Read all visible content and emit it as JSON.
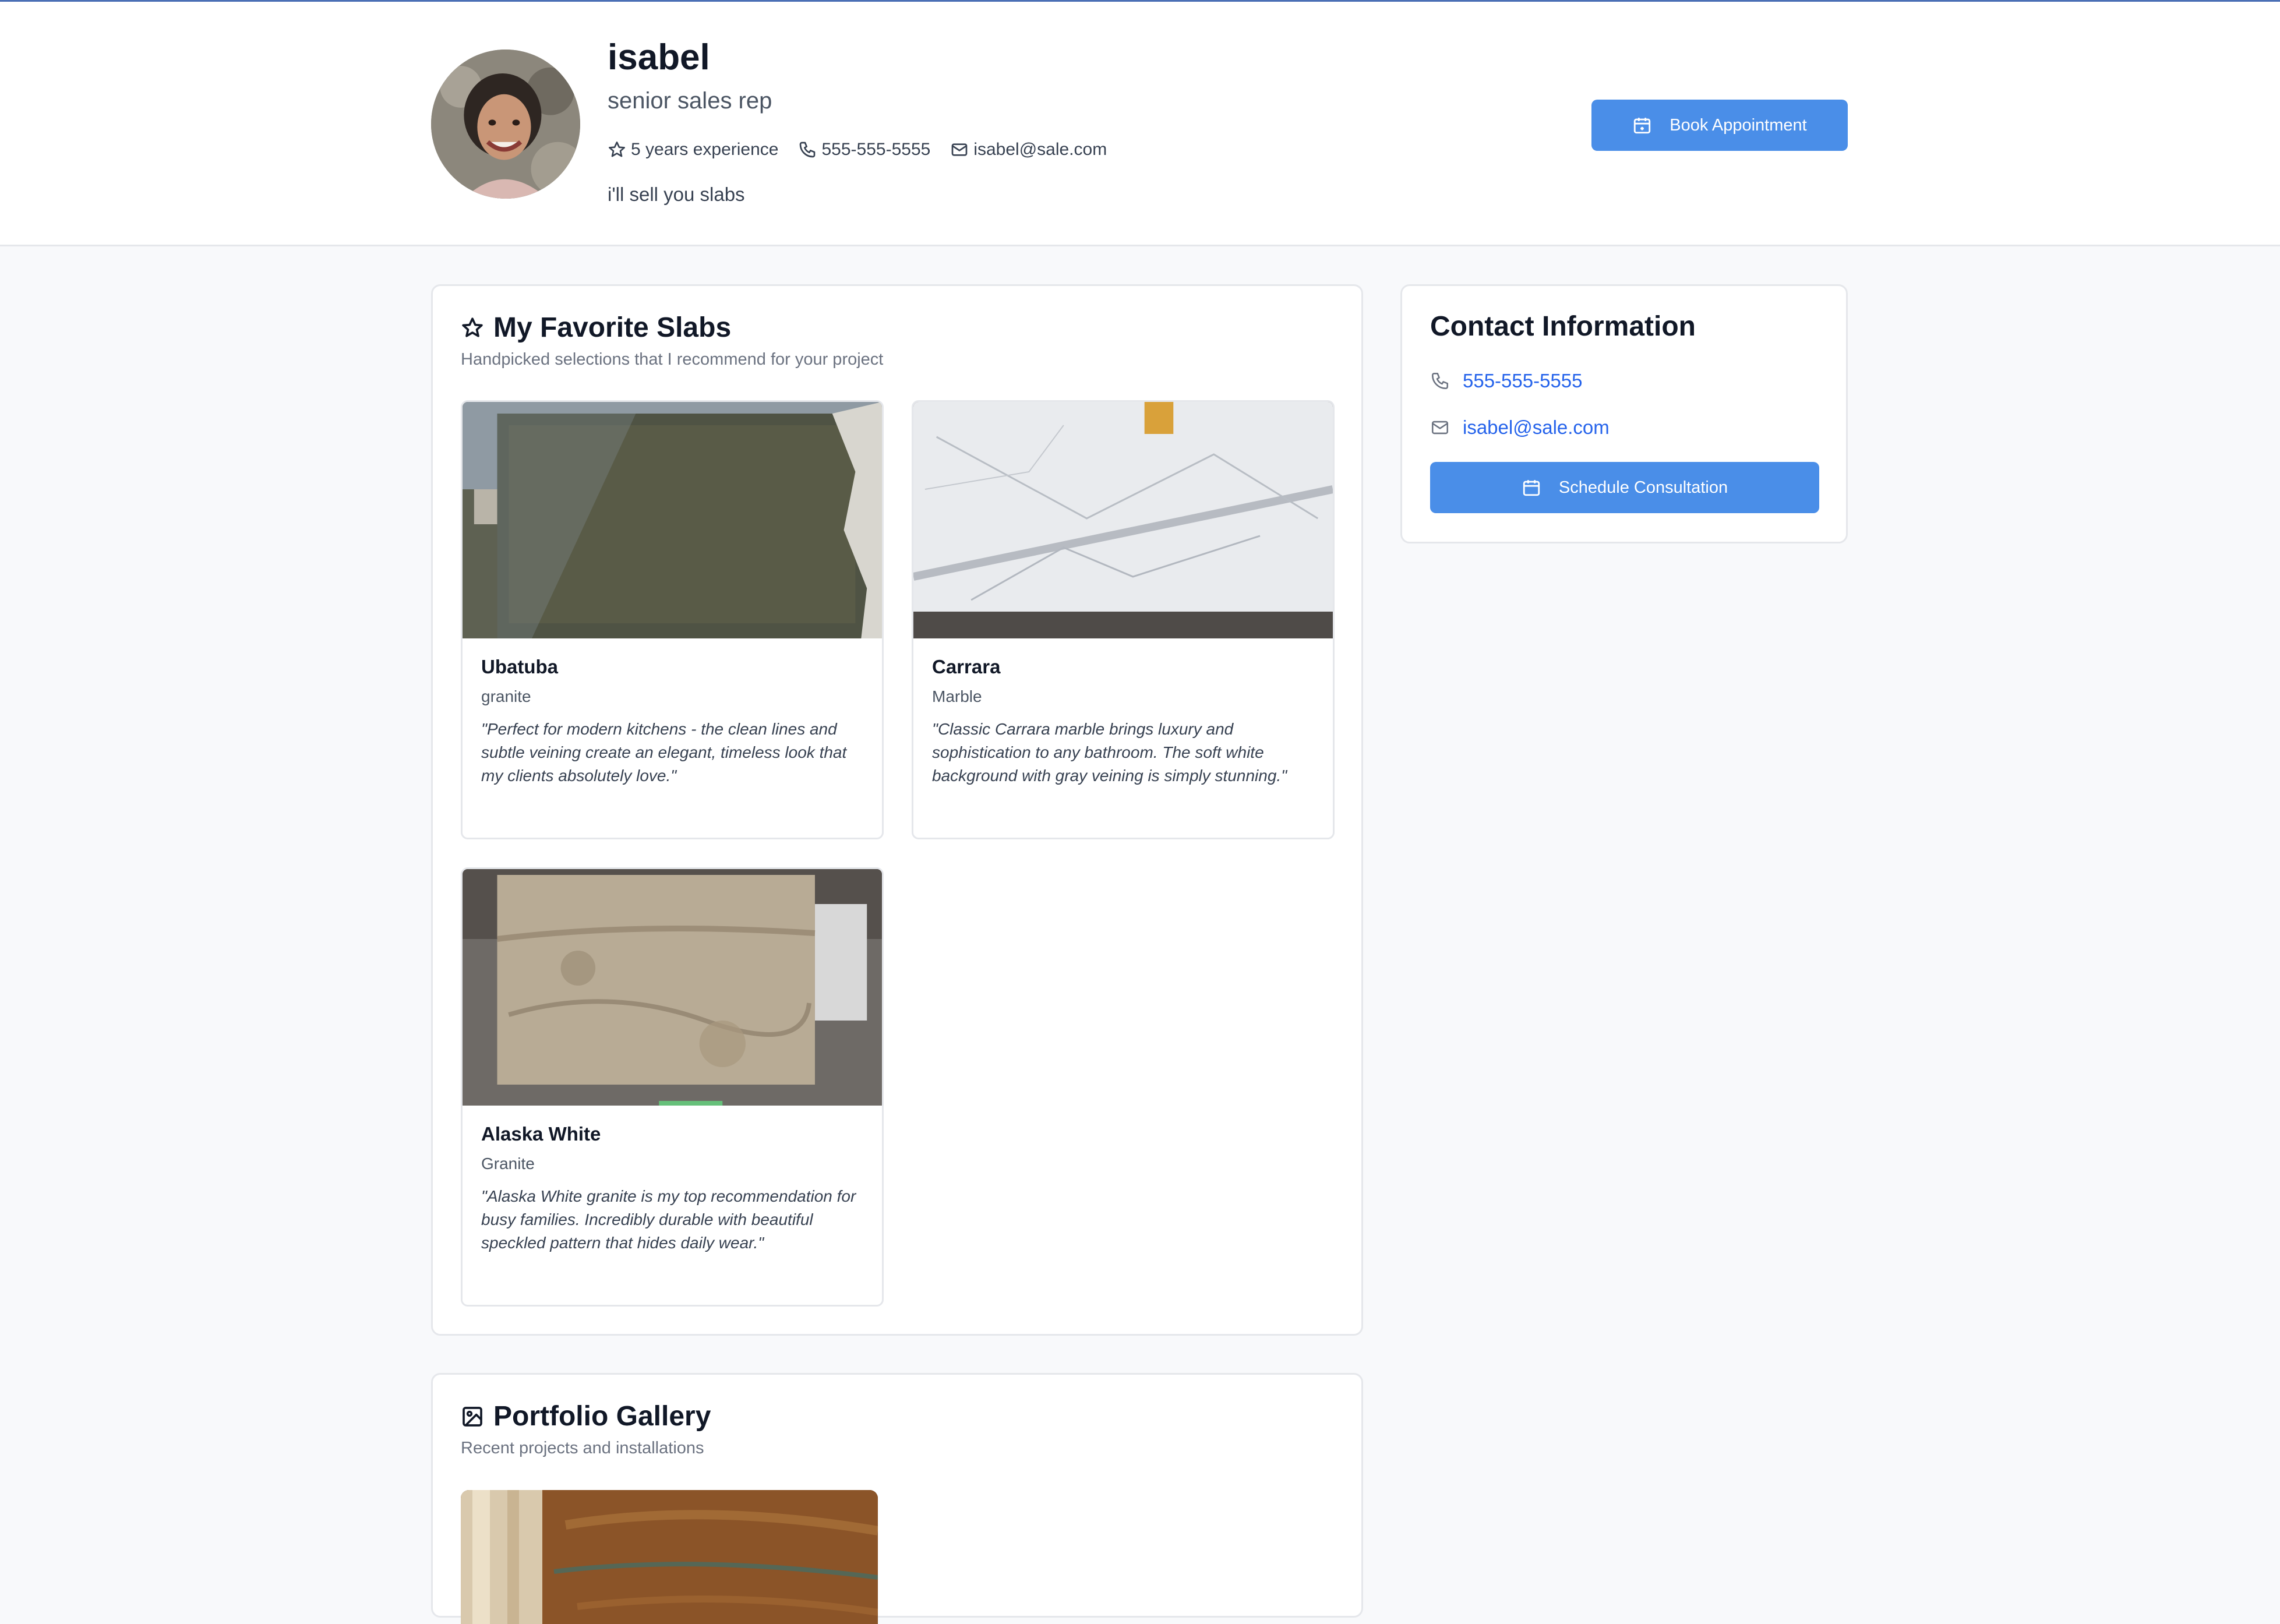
{
  "profile": {
    "name": "isabel",
    "role": "senior sales rep",
    "experience": "5 years experience",
    "phone": "555-555-5555",
    "email": "isabel@sale.com",
    "bio": "i'll sell you slabs",
    "book_label": "Book Appointment"
  },
  "favorites": {
    "title": "My Favorite Slabs",
    "subtitle": "Handpicked selections that I recommend for your project",
    "slabs": [
      {
        "name": "Ubatuba",
        "type": "granite",
        "quote": "\"Perfect for modern kitchens - the clean lines and subtle veining create an elegant, timeless look that my clients absolutely love.\""
      },
      {
        "name": "Carrara",
        "type": "Marble",
        "quote": "\"Classic Carrara marble brings luxury and sophistication to any bathroom. The soft white background with gray veining is simply stunning.\""
      },
      {
        "name": "Alaska White",
        "type": "Granite",
        "quote": "\"Alaska White granite is my top recommendation for busy families. Incredibly durable with beautiful speckled pattern that hides daily wear.\""
      }
    ]
  },
  "contact": {
    "title": "Contact Information",
    "phone": "555-555-5555",
    "email": "isabel@sale.com",
    "consult_label": "Schedule Consultation"
  },
  "gallery": {
    "title": "Portfolio Gallery",
    "subtitle": "Recent projects and installations"
  },
  "colors": {
    "accent": "#4a8ee8",
    "link": "#2563eb",
    "background": "#f8f9fb"
  }
}
